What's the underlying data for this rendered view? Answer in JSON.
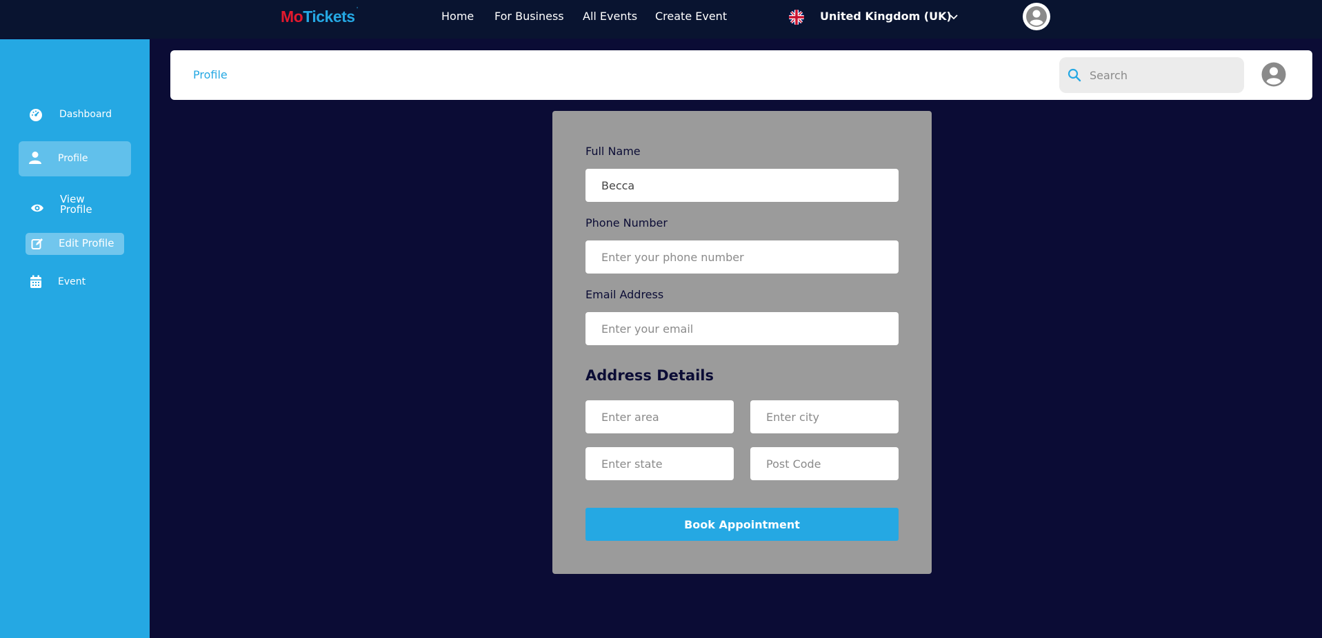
{
  "brand": {
    "part1": "Mo",
    "part2": "Tickets",
    "mark": "'"
  },
  "topnav": {
    "links": [
      "Home",
      "For Business",
      "All Events",
      "Create Event"
    ],
    "country": "United Kingdom (UK)",
    "flag_icon": "uk-flag-icon",
    "avatar_icon": "user-avatar-icon"
  },
  "sidebar": {
    "items": [
      {
        "label": "Dashboard",
        "icon": "dashboard-gauge-icon"
      },
      {
        "label": "Profile",
        "icon": "user-icon"
      },
      {
        "label": "View Profile",
        "icon": "eye-icon"
      },
      {
        "label": "Edit Profile",
        "icon": "edit-icon"
      },
      {
        "label": "Event",
        "icon": "calendar-icon"
      }
    ]
  },
  "header": {
    "breadcrumb": "Profile",
    "search_placeholder": "Search",
    "search_icon": "search-icon",
    "avatar_icon": "user-avatar-icon"
  },
  "form": {
    "full_name_label": "Full Name",
    "full_name_value": "Becca",
    "phone_label": "Phone Number",
    "phone_placeholder": "Enter your phone number",
    "email_label": "Email Address",
    "email_placeholder": "Enter your email",
    "address_title": "Address Details",
    "area_placeholder": "Enter area",
    "city_placeholder": "Enter city",
    "state_placeholder": "Enter state",
    "postcode_placeholder": "Post Code",
    "submit_label": "Book Appointment"
  },
  "colors": {
    "topbar": "#091430",
    "sidebar": "#25a8e3",
    "background": "#0b0c35",
    "form_card": "#9b9b9b",
    "accent": "#25a8e3",
    "brand_red": "#e3192d"
  }
}
